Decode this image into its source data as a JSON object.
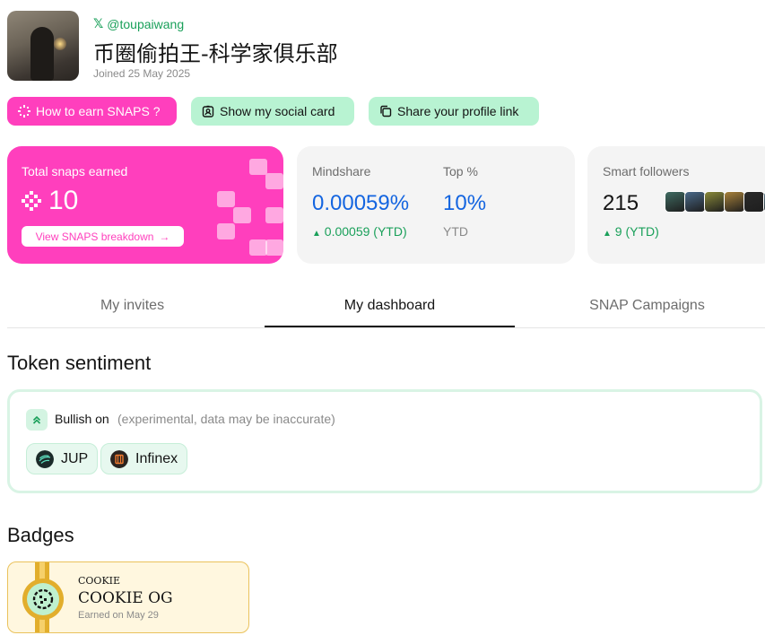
{
  "profile": {
    "handle": "@toupaiwang",
    "display_name": "币圈偷拍王-科学家俱乐部",
    "joined": "Joined 25 May 2025"
  },
  "actions": {
    "earn": "How to earn SNAPS ?",
    "social_card": "Show my social card",
    "share_link": "Share your profile link"
  },
  "snaps_card": {
    "label": "Total snaps earned",
    "value": "10",
    "breakdown_label": "View SNAPS breakdown"
  },
  "mindshare": {
    "label": "Mindshare",
    "value": "0.00059%",
    "change": "0.00059 (YTD)",
    "top_label": "Top %",
    "top_value": "10%",
    "top_period": "YTD"
  },
  "smart_followers": {
    "label": "Smart followers",
    "value": "215",
    "change": "9 (YTD)",
    "avatar_colors": [
      "#3f6b62",
      "#4a6a8a",
      "#8a8a3a",
      "#a8823a",
      "#2a2a2a",
      "#5a7a8a"
    ]
  },
  "tabs": [
    {
      "label": "My invites",
      "active": false
    },
    {
      "label": "My dashboard",
      "active": true
    },
    {
      "label": "SNAP Campaigns",
      "active": false
    }
  ],
  "sentiment": {
    "title": "Token sentiment",
    "bullish_label": "Bullish on",
    "note": "(experimental, data may be inaccurate)",
    "tokens": [
      {
        "name": "JUP",
        "icon": "jup-token-icon",
        "color": "#1b2b2a"
      },
      {
        "name": "Infinex",
        "icon": "infinex-token-icon",
        "color": "#2b2420"
      }
    ]
  },
  "badges": {
    "title": "Badges",
    "items": [
      {
        "small": "COOKIE",
        "title": "COOKIE OG",
        "earned": "Earned on May 29"
      }
    ]
  },
  "colors": {
    "accent_pink": "#ff3fbd",
    "mint": "#b8f3d2",
    "blue": "#1465e0",
    "green": "#1aa05a"
  }
}
